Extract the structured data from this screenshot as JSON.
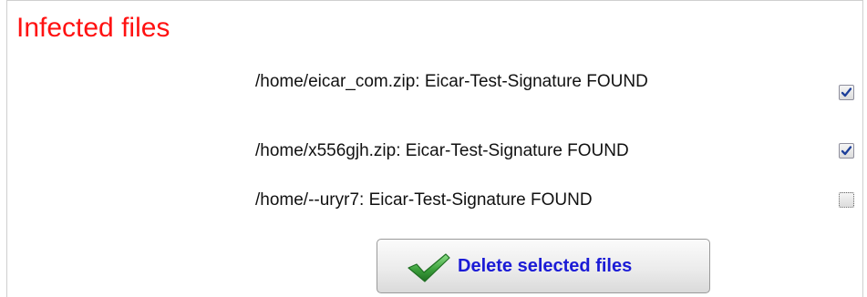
{
  "section": {
    "title": "Infected files"
  },
  "infected_files": [
    {
      "label": "/home/eicar_com.zip: Eicar-Test-Signature FOUND",
      "checked": true
    },
    {
      "label": "/home/x556gjh.zip: Eicar-Test-Signature FOUND",
      "checked": true
    },
    {
      "label": "/home/--uryr7: Eicar-Test-Signature FOUND",
      "checked": false
    }
  ],
  "actions": {
    "delete_label": "Delete selected files",
    "delete_icon": "checkmark-icon"
  },
  "colors": {
    "title": "#ff1111",
    "button_text": "#1b1bd6",
    "checkmark": "#3da23d"
  }
}
